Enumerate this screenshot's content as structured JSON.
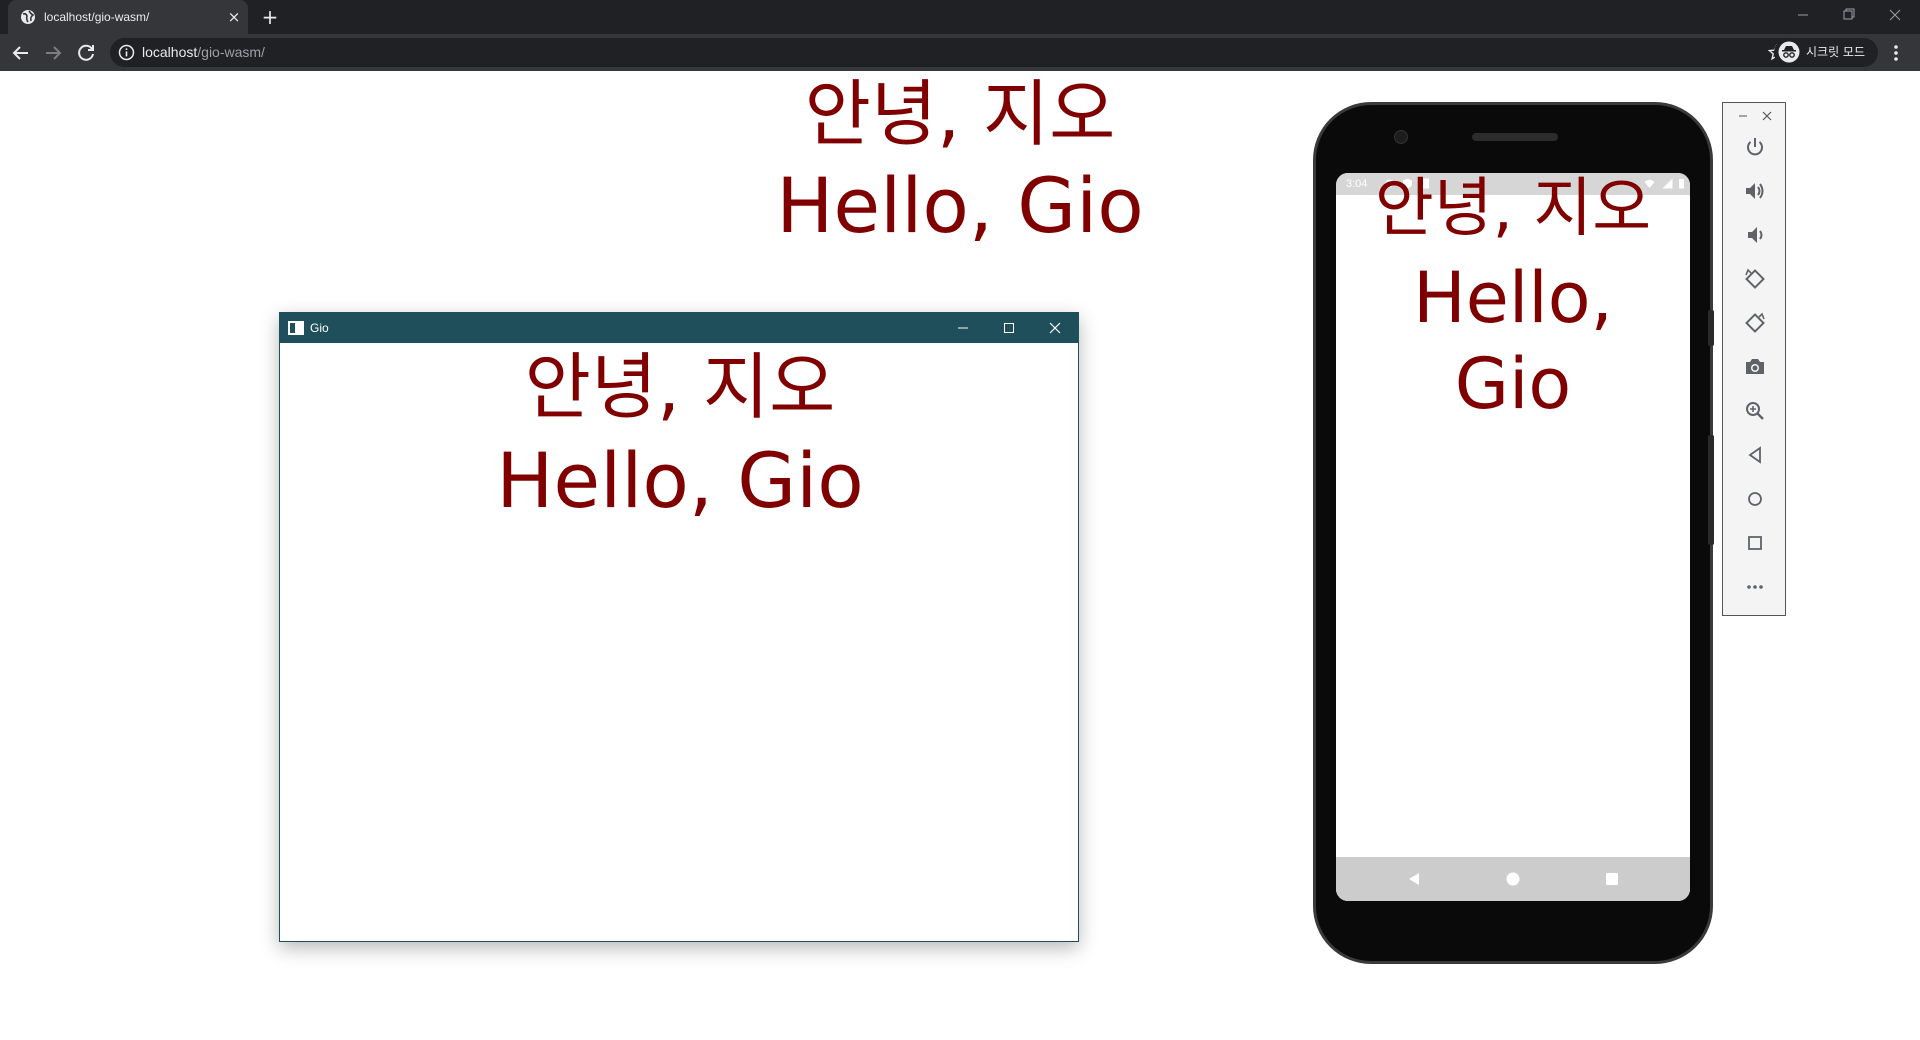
{
  "browser": {
    "tab": {
      "title": "localhost/gio-wasm/",
      "favicon": "globe-icon",
      "close_label": "×"
    },
    "new_tab_label": "+",
    "address": {
      "host": "localhost",
      "path": "/gio-wasm/"
    },
    "incognito_label": "시크릿 모드"
  },
  "page": {
    "greeting_korean": "안녕, 지오",
    "greeting_english": "Hello, Gio"
  },
  "desktop_window": {
    "title": "Gio",
    "greeting_korean": "안녕, 지오",
    "greeting_english": "Hello, Gio",
    "titlebar_color": "#1e4f5b"
  },
  "android": {
    "status_time": "3:04",
    "greeting_korean": "안녕, 지오",
    "greeting_english_line1": "Hello,",
    "greeting_english_line2": "Gio",
    "toolbar_buttons": [
      "power-icon",
      "volume-up-icon",
      "volume-down-icon",
      "rotate-left-icon",
      "rotate-right-icon",
      "camera-icon",
      "zoom-icon",
      "back-icon",
      "home-icon",
      "overview-icon",
      "more-icon"
    ]
  },
  "colors": {
    "text": "#800000",
    "chrome_dark": "#202124",
    "chrome_toolbar": "#35363a"
  }
}
